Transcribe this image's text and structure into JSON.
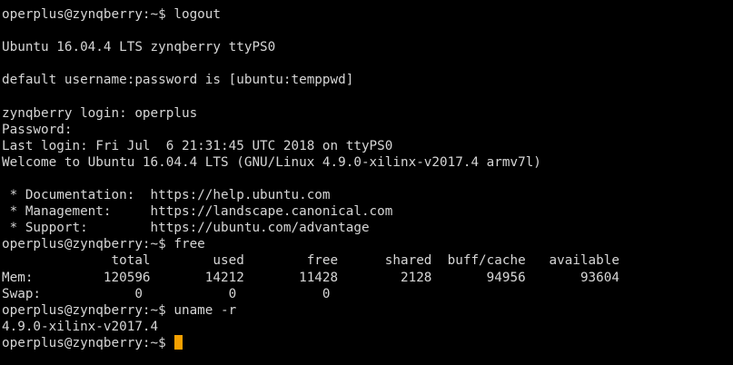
{
  "terminal": {
    "lines": [
      "operplus@zynqberry:~$ logout",
      "",
      "Ubuntu 16.04.4 LTS zynqberry ttyPS0",
      "",
      "default username:password is [ubuntu:temppwd]",
      "",
      "zynqberry login: operplus",
      "Password:",
      "Last login: Fri Jul  6 21:31:45 UTC 2018 on ttyPS0",
      "Welcome to Ubuntu 16.04.4 LTS (GNU/Linux 4.9.0-xilinx-v2017.4 armv7l)",
      "",
      " * Documentation:  https://help.ubuntu.com",
      " * Management:     https://landscape.canonical.com",
      " * Support:        https://ubuntu.com/advantage",
      "operplus@zynqberry:~$ free",
      "              total        used        free      shared  buff/cache   available",
      "Mem:         120596       14212       11428        2128       94956       93604",
      "Swap:            0           0           0",
      "operplus@zynqberry:~$ uname -r",
      "4.9.0-xilinx-v2017.4"
    ],
    "prompt": "operplus@zynqberry:~$",
    "cursor_color": "#f5a000"
  }
}
